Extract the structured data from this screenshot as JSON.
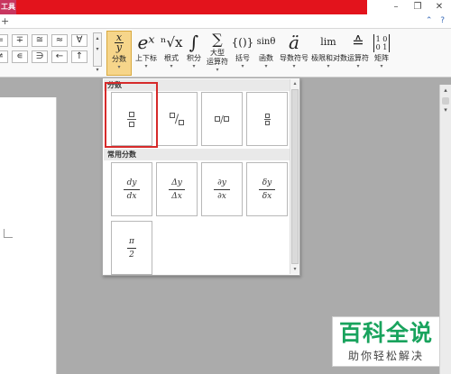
{
  "titlebar": {
    "tool_tab": "工具",
    "min": "–",
    "restore": "❐",
    "close": "✕"
  },
  "tabrow": {
    "plus": "+",
    "help": "⌃ ?"
  },
  "ribbon": {
    "symbols": [
      "∓",
      "≅",
      "≈",
      "∀",
      "∊",
      "∋",
      "←",
      "↑"
    ],
    "symbols_left": [
      "=",
      "≠"
    ],
    "scroll_up": "▴",
    "scroll_down": "▾",
    "more": "▾",
    "buttons": [
      {
        "glyph": "x/y",
        "label": "分数",
        "dd": "▾"
      },
      {
        "glyph": "eˣ",
        "label": "上下标",
        "dd": "▾"
      },
      {
        "glyph": "ⁿ√x",
        "label": "根式",
        "dd": "▾"
      },
      {
        "glyph": "∫",
        "label": "积分",
        "dd": "▾"
      },
      {
        "glyph": "∑",
        "label": "大型",
        "label2": "运算符",
        "dd": "▾"
      },
      {
        "glyph": "{()}",
        "label": "括号",
        "dd": "▾"
      },
      {
        "glyph": "sinθ",
        "label": "函数",
        "dd": "▾"
      },
      {
        "glyph": "ä",
        "label": "导数符号",
        "dd": "▾"
      },
      {
        "glyph": "lim",
        "label": "极限和对数",
        "dd": "▾"
      },
      {
        "glyph": "≙",
        "label": "运算符",
        "dd": "▾"
      },
      {
        "glyph": "[1 0; 0 1]",
        "label": "矩阵",
        "dd": "▾"
      }
    ]
  },
  "panel": {
    "section1": "分数",
    "section2": "常用分数",
    "tiles": {
      "dydx": {
        "num": "dy",
        "den": "dx"
      },
      "DyDx": {
        "num": "Δy",
        "den": "Δx"
      },
      "partial": {
        "num": "∂y",
        "den": "∂x"
      },
      "delta": {
        "num": "δy",
        "den": "δx"
      },
      "pi2": {
        "num": "π",
        "den": "2"
      }
    },
    "skew_slash": "/",
    "linear_slash": "/",
    "scroll_up": "▴",
    "scroll_down": "▾"
  },
  "vscroll": {
    "up": "▴",
    "down": "▾"
  },
  "watermark": {
    "title": "百科全说",
    "subtitle": "助你轻松解决"
  },
  "colors": {
    "title_red": "#e3131c",
    "highlight_red": "#d62a2a",
    "watermark_green": "#19a35d",
    "ribbon_selected": "#f6d58a"
  }
}
